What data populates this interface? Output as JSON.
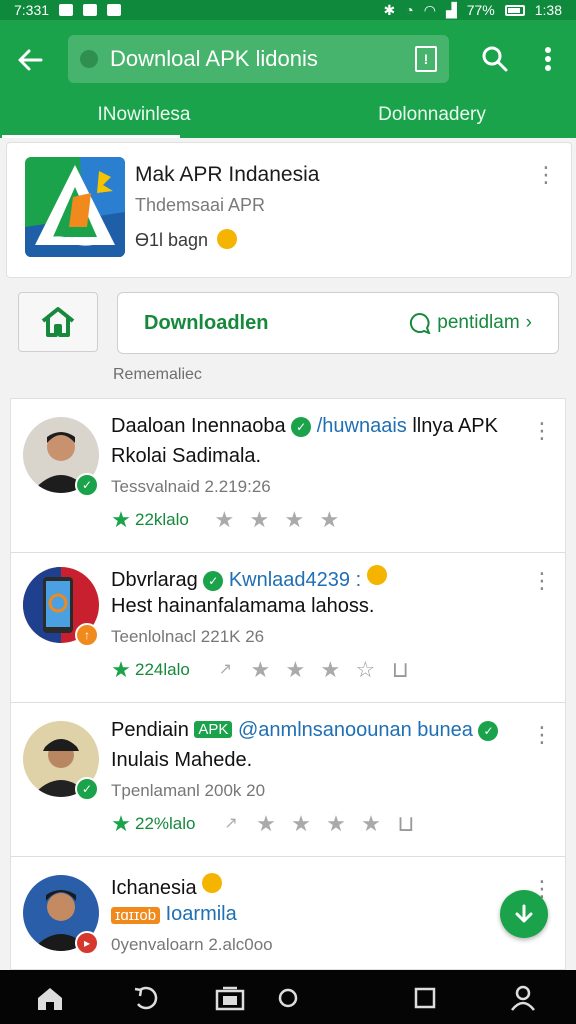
{
  "status_bar": {
    "time_left": "7:331",
    "battery": "77%",
    "time_right": "1:38"
  },
  "toolbar": {
    "url": "Downloal APK lidonis",
    "back_icon": "arrow-left-icon",
    "share_icon": "share-icon"
  },
  "tabs": [
    {
      "label": "INowinlesa"
    },
    {
      "label": "Dolonnadery"
    }
  ],
  "app": {
    "title": "Mak APR Indanesia",
    "subtitle": "Thdemsaai APR",
    "meta": "Ɵ1l bagn"
  },
  "actions": {
    "download_label": "Downloadlen",
    "pending_label": "pentidlam"
  },
  "section_label": "Rememaliec",
  "items": [
    {
      "title_a": "Daaloan Inennaoba",
      "title_tag": "/huwnaais",
      "title_b": " llnya APK",
      "line2": "Rkolai Sadimala.",
      "meta": "Tessvalnaid 2.219:26",
      "count": "22klalo"
    },
    {
      "title_a": "Dbvrlarag",
      "title_tag": "Kwnlaad4239 :",
      "title_b": "",
      "line2": "Hest hainanfalamama lahoss.",
      "meta": "Teenlolnacl 221K 26",
      "count": "224lalo"
    },
    {
      "title_a": "Pendiain",
      "chip": "APK",
      "title_tag": "@anmlnsanoounan bunea",
      "title_b": "",
      "line2": "Inulais Mahede.",
      "meta": "Tpenlamanl 200k 20",
      "count": "22%lalo"
    },
    {
      "title_a": "Ichanesia",
      "chip": "ɪɑɪɪob",
      "title_tag": "Ioarmila",
      "title_b": "",
      "line2": "",
      "meta": "0yenvaloarn 2.alc0oo",
      "count": ""
    }
  ],
  "colors": {
    "primary": "#1aa34a",
    "primary_dark": "#0f8a3c",
    "link": "#1f6fb5"
  }
}
